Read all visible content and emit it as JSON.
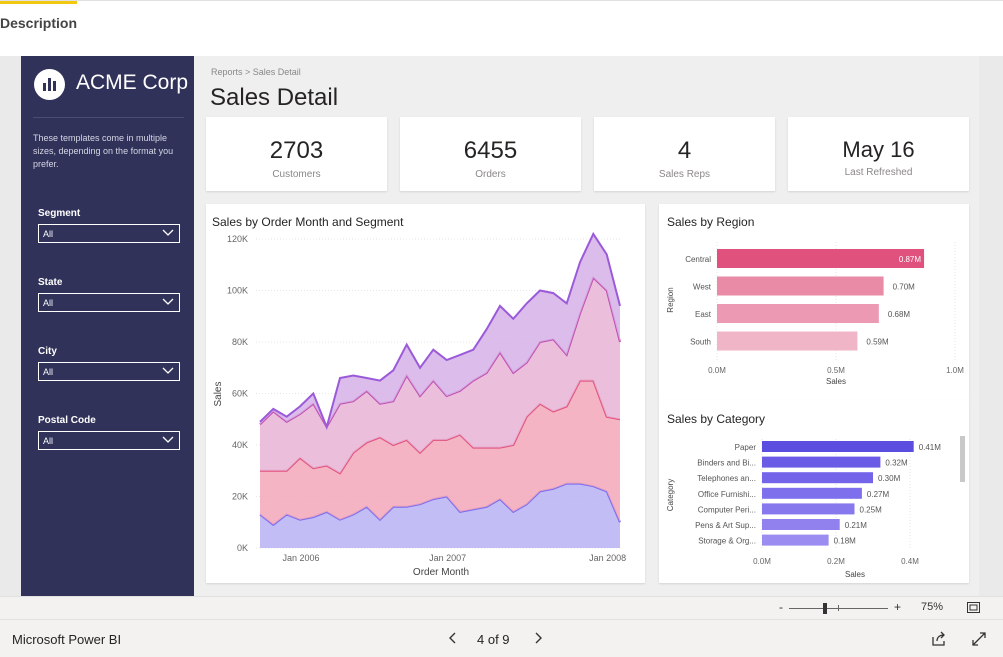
{
  "tabs": {
    "description": "Description"
  },
  "sidebar": {
    "brand": "ACME Corp",
    "blurb": "These templates come in multiple sizes, depending on the format you prefer.",
    "filters": [
      {
        "label": "Segment",
        "value": "All"
      },
      {
        "label": "State",
        "value": "All"
      },
      {
        "label": "City",
        "value": "All"
      },
      {
        "label": "Postal Code",
        "value": "All"
      }
    ]
  },
  "header": {
    "breadcrumb": "Reports > Sales Detail",
    "title": "Sales Detail"
  },
  "kpis": [
    {
      "value": "2703",
      "label": "Customers"
    },
    {
      "value": "6455",
      "label": "Orders"
    },
    {
      "value": "4",
      "label": "Sales Reps"
    },
    {
      "value": "May 16",
      "label": "Last Refreshed"
    }
  ],
  "colors": {
    "sidebar": "#30325a",
    "accent": "#f2c811",
    "region_bar": "#e0527d",
    "category_bar": "#6b5ce7"
  },
  "chart_data": [
    {
      "type": "area",
      "title": "Sales by Order Month and Segment",
      "xlabel": "Order Month",
      "ylabel": "Sales",
      "ylim": [
        0,
        120000
      ],
      "yticks": [
        "0K",
        "20K",
        "40K",
        "60K",
        "80K",
        "100K",
        "120K"
      ],
      "xticks": [
        "Jan 2006",
        "Jan 2007",
        "Jan 2008"
      ],
      "stacked": true,
      "series": [
        {
          "color": "#7b6cf0",
          "values": [
            13000,
            9000,
            13000,
            11000,
            12000,
            14000,
            11000,
            13000,
            16000,
            11000,
            16000,
            16000,
            17000,
            19000,
            20000,
            14000,
            15000,
            16000,
            19000,
            14000,
            17000,
            22000,
            23000,
            25000,
            25000,
            24000,
            22000,
            10000
          ]
        },
        {
          "color": "#e0527d",
          "values": [
            17000,
            21000,
            17000,
            24000,
            19000,
            18000,
            18000,
            24000,
            25000,
            32000,
            24000,
            26000,
            20000,
            23000,
            22000,
            30000,
            24000,
            23000,
            20000,
            26000,
            34000,
            34000,
            30000,
            30000,
            40000,
            41000,
            29000,
            40000
          ]
        },
        {
          "color": "#c14fb0",
          "values": [
            18000,
            23000,
            19000,
            17000,
            25000,
            15000,
            27000,
            20000,
            20000,
            13000,
            17000,
            25000,
            22000,
            23000,
            17000,
            17000,
            26000,
            29000,
            37000,
            28000,
            21000,
            24000,
            28000,
            20000,
            26000,
            40000,
            49000,
            30000
          ]
        },
        {
          "color": "#9b5ad9",
          "values": [
            1000,
            1000,
            2000,
            3000,
            4000,
            0,
            10000,
            10000,
            5000,
            9000,
            12000,
            12000,
            11000,
            12000,
            14000,
            14000,
            12000,
            17000,
            18000,
            21000,
            23000,
            20000,
            18000,
            20000,
            20000,
            17000,
            14000,
            14000
          ]
        }
      ]
    },
    {
      "type": "bar",
      "orientation": "horizontal",
      "title": "Sales by Region",
      "xlabel": "Sales",
      "ylabel": "Region",
      "xlim": [
        0,
        1.0
      ],
      "xticks": [
        "0.0M",
        "0.5M",
        "1.0M"
      ],
      "categories": [
        "Central",
        "West",
        "East",
        "South"
      ],
      "values": [
        0.87,
        0.7,
        0.68,
        0.59
      ],
      "labels": [
        "0.87M",
        "0.70M",
        "0.68M",
        "0.59M"
      ]
    },
    {
      "type": "bar",
      "orientation": "horizontal",
      "title": "Sales by Category",
      "xlabel": "Sales",
      "ylabel": "Category",
      "xlim": [
        0,
        0.4
      ],
      "xticks": [
        "0.0M",
        "0.2M",
        "0.4M"
      ],
      "categories": [
        "Paper",
        "Binders and Bi...",
        "Telephones an...",
        "Office Furnishi...",
        "Computer Peri...",
        "Pens & Art Sup...",
        "Storage & Org..."
      ],
      "values": [
        0.41,
        0.32,
        0.3,
        0.27,
        0.25,
        0.21,
        0.18
      ],
      "labels": [
        "0.41M",
        "0.32M",
        "0.30M",
        "0.27M",
        "0.25M",
        "0.21M",
        "0.18M"
      ]
    }
  ],
  "zoom": {
    "minus": "-",
    "plus": "+",
    "level": "75%"
  },
  "footer": {
    "app": "Microsoft Power BI",
    "pager": "4 of 9"
  }
}
